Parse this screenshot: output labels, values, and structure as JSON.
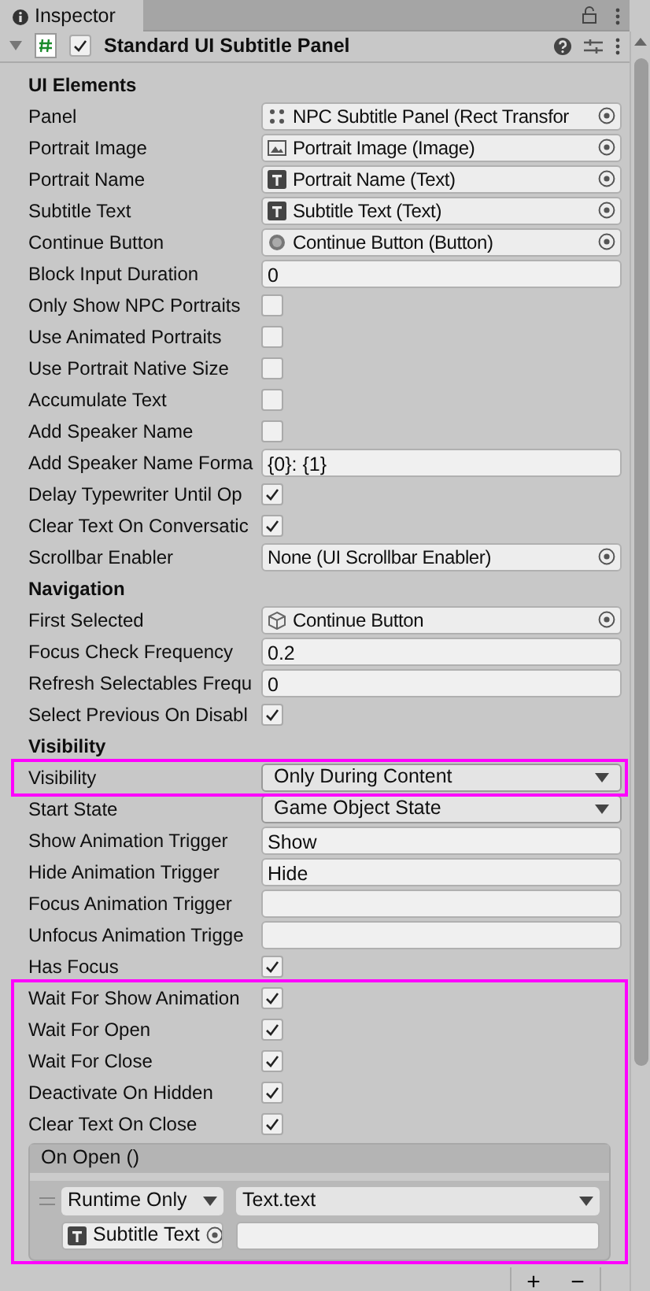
{
  "tab": {
    "title": "Inspector"
  },
  "component": {
    "title": "Standard UI Subtitle Panel",
    "enabled": true,
    "expanded": true
  },
  "blocks": [
    {
      "highlighted": false,
      "rows": [
        {
          "kind": "header",
          "label": "UI Elements"
        },
        {
          "kind": "rect-object",
          "label": "Panel",
          "value": "NPC Subtitle Panel (Rect Transfor"
        },
        {
          "kind": "image-object",
          "label": "Portrait Image",
          "value": "Portrait Image (Image)"
        },
        {
          "kind": "text-object",
          "label": "Portrait Name",
          "value": "Portrait Name (Text)"
        },
        {
          "kind": "text-object",
          "label": "Subtitle Text",
          "value": "Subtitle Text (Text)"
        },
        {
          "kind": "button-object",
          "label": "Continue Button",
          "value": "Continue Button (Button)"
        },
        {
          "kind": "field",
          "label": "Block Input Duration",
          "value": "0"
        },
        {
          "kind": "checkbox",
          "label": "Only Show NPC Portraits",
          "checked": false
        },
        {
          "kind": "checkbox",
          "label": "Use Animated Portraits",
          "checked": false
        },
        {
          "kind": "checkbox",
          "label": "Use Portrait Native Size",
          "checked": false
        },
        {
          "kind": "checkbox",
          "label": "Accumulate Text",
          "checked": false
        },
        {
          "kind": "checkbox",
          "label": "Add Speaker Name",
          "checked": false
        },
        {
          "kind": "field",
          "label": "Add Speaker Name Forma",
          "value": "{0}: {1}"
        },
        {
          "kind": "checkbox",
          "label": "Delay Typewriter Until Op",
          "checked": true
        },
        {
          "kind": "checkbox",
          "label": "Clear Text On Conversatic",
          "checked": true
        },
        {
          "kind": "object",
          "label": "Scrollbar Enabler",
          "value": "None (UI Scrollbar Enabler)"
        },
        {
          "kind": "header",
          "label": "Navigation"
        },
        {
          "kind": "gameobject-object",
          "label": "First Selected",
          "value": "Continue Button"
        },
        {
          "kind": "field",
          "label": "Focus Check Frequency",
          "value": "0.2"
        },
        {
          "kind": "field",
          "label": "Refresh Selectables Frequ",
          "value": "0"
        },
        {
          "kind": "checkbox",
          "label": "Select Previous On Disabl",
          "checked": true
        },
        {
          "kind": "header",
          "label": "Visibility"
        }
      ]
    },
    {
      "highlighted": true,
      "rows": [
        {
          "kind": "dropdown",
          "label": "Visibility",
          "value": "Only During Content"
        }
      ]
    },
    {
      "highlighted": false,
      "rows": [
        {
          "kind": "dropdown",
          "label": "Start State",
          "value": "Game Object State"
        },
        {
          "kind": "field",
          "label": "Show Animation Trigger",
          "value": "Show"
        },
        {
          "kind": "field",
          "label": "Hide Animation Trigger",
          "value": "Hide"
        },
        {
          "kind": "field",
          "label": "Focus Animation Trigger",
          "value": ""
        },
        {
          "kind": "field",
          "label": "Unfocus Animation Trigge",
          "value": ""
        },
        {
          "kind": "checkbox",
          "label": "Has Focus",
          "checked": true
        }
      ]
    },
    {
      "highlighted": true,
      "rows": [
        {
          "kind": "checkbox",
          "label": "Wait For Show Animation",
          "checked": true
        },
        {
          "kind": "checkbox",
          "label": "Wait For Open",
          "checked": true
        },
        {
          "kind": "checkbox",
          "label": "Wait For Close",
          "checked": true
        },
        {
          "kind": "checkbox",
          "label": "Deactivate On Hidden",
          "checked": true
        },
        {
          "kind": "checkbox",
          "label": "Clear Text On Close",
          "checked": true
        }
      ],
      "event": {
        "title": "On Open ()",
        "mode": "Runtime Only",
        "function": "Text.text",
        "target": "Subtitle Text"
      }
    }
  ],
  "footer": {
    "add": "+",
    "remove": "−"
  }
}
